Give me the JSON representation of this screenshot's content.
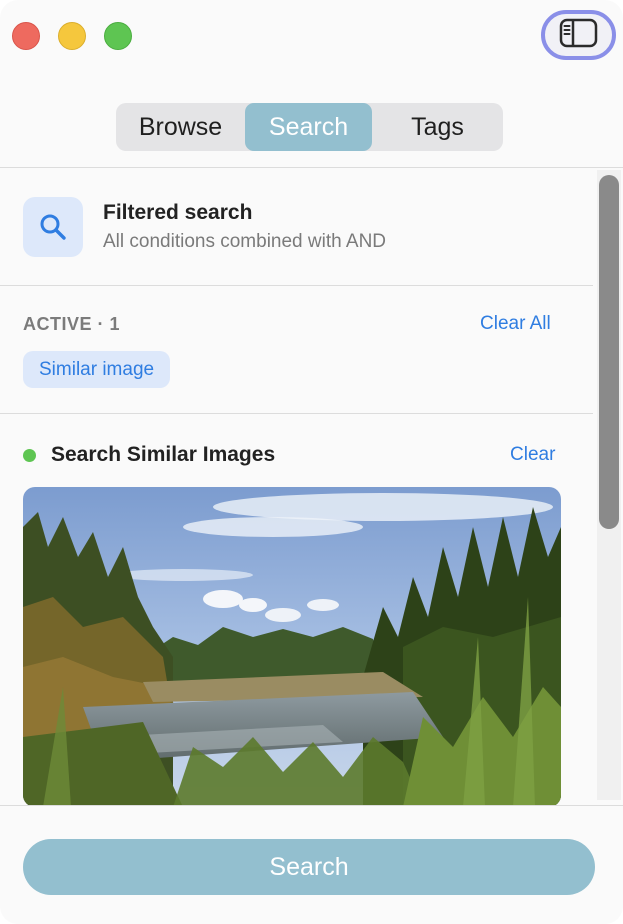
{
  "tabs": [
    {
      "label": "Browse",
      "active": false
    },
    {
      "label": "Search",
      "active": true
    },
    {
      "label": "Tags",
      "active": false
    }
  ],
  "header": {
    "title": "Filtered search",
    "subtitle": "All conditions combined with AND",
    "icon": "search-icon"
  },
  "active_filters": {
    "label": "ACTIVE · 1",
    "clear_all_label": "Clear All",
    "chips": [
      "Similar image"
    ]
  },
  "similar_images": {
    "title": "Search Similar Images",
    "clear_label": "Clear",
    "status_color": "#5ec552",
    "image_description": "river-landscape-photo"
  },
  "footer": {
    "search_button_label": "Search"
  },
  "colors": {
    "accent": "#93bfcf",
    "link": "#2f7de1",
    "chip_bg": "#dde8fa",
    "toggle_ring": "#8a8fe8"
  }
}
